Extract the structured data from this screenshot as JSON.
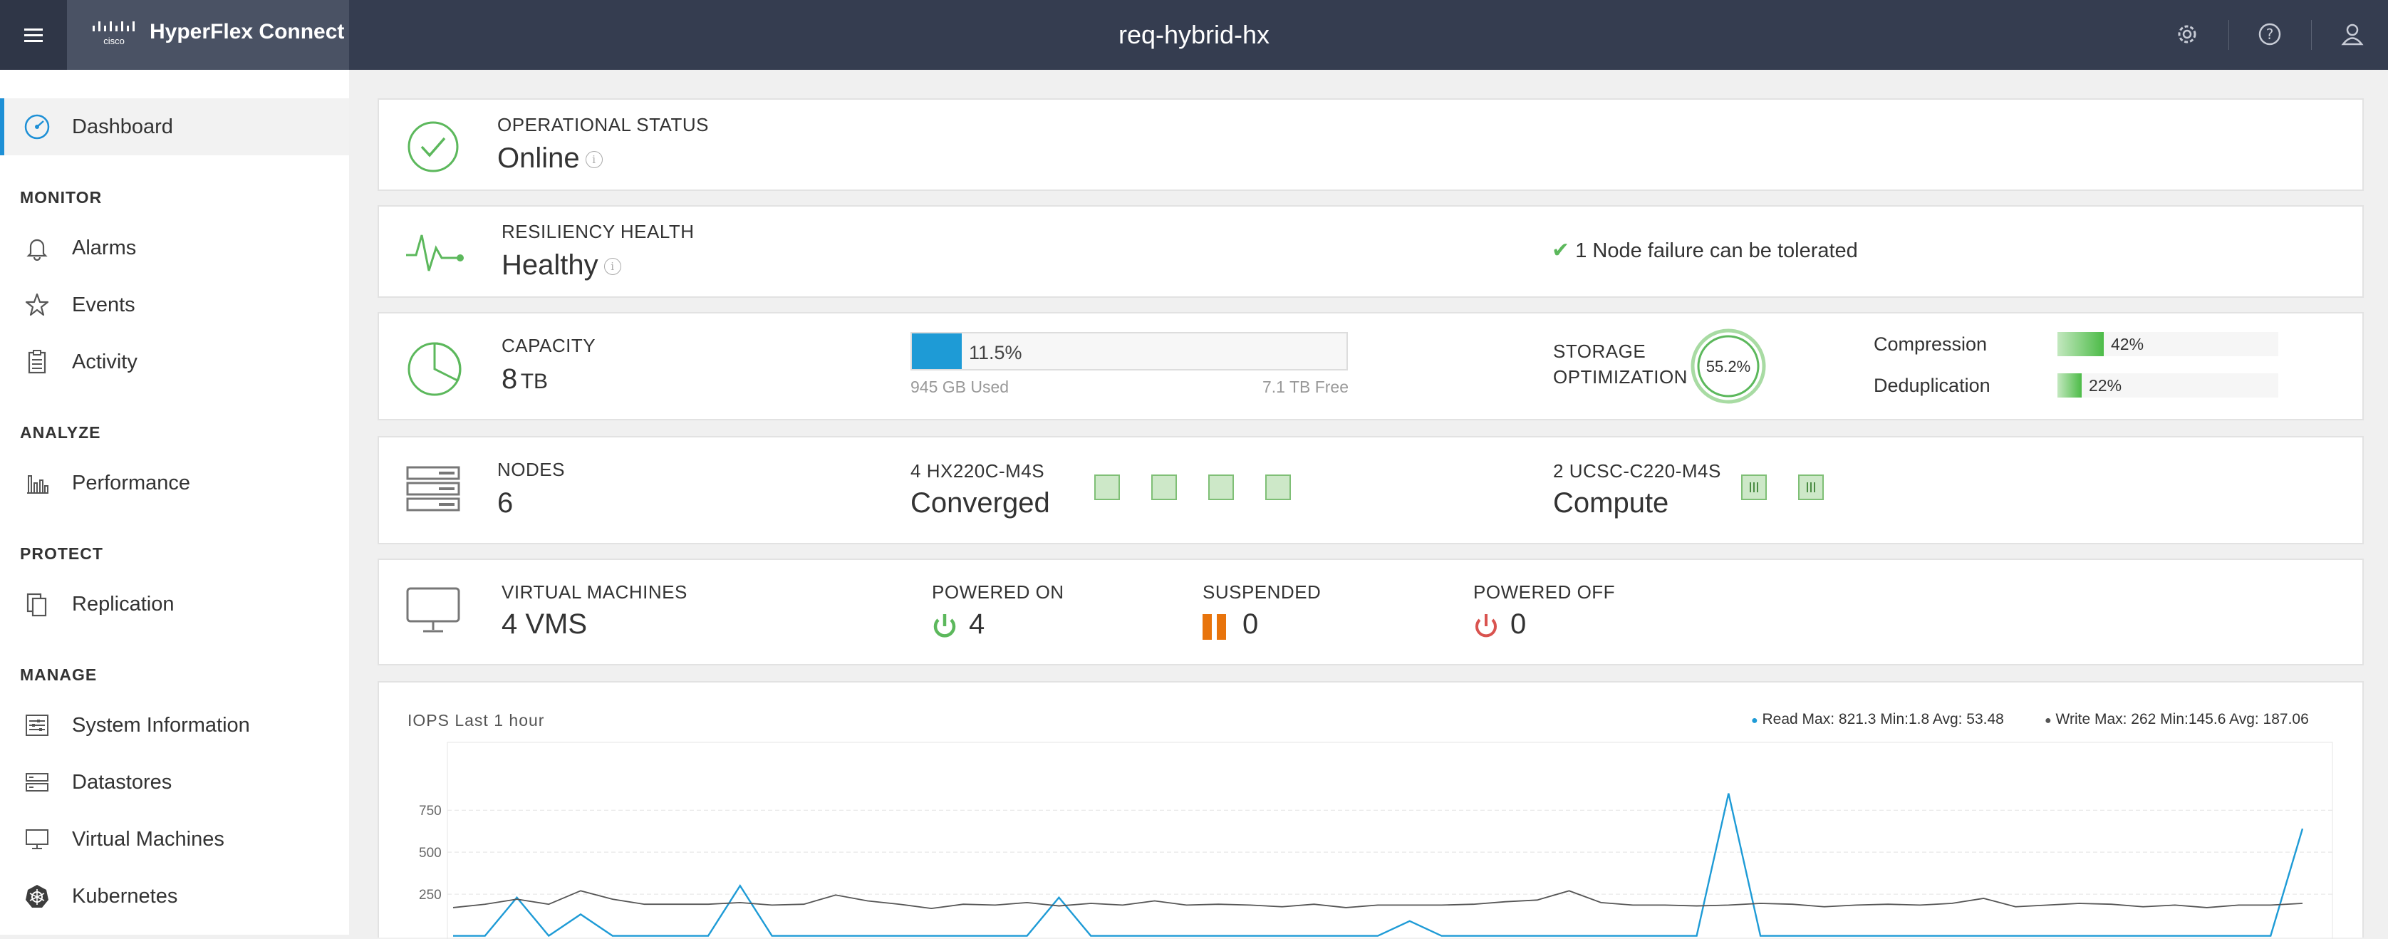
{
  "header": {
    "product": "HyperFlex Connect",
    "cluster_name": "req-hybrid-hx",
    "icons": [
      "menu-icon",
      "settings-icon",
      "help-icon",
      "user-icon"
    ]
  },
  "sidebar": {
    "dashboard": "Dashboard",
    "sections": {
      "monitor": "MONITOR",
      "analyze": "ANALYZE",
      "protect": "PROTECT",
      "manage": "MANAGE"
    },
    "items": {
      "alarms": "Alarms",
      "events": "Events",
      "activity": "Activity",
      "performance": "Performance",
      "replication": "Replication",
      "system_information": "System Information",
      "datastores": "Datastores",
      "virtual_machines": "Virtual Machines",
      "kubernetes": "Kubernetes"
    }
  },
  "operational": {
    "caption": "OPERATIONAL STATUS",
    "value": "Online"
  },
  "resiliency": {
    "caption": "RESILIENCY HEALTH",
    "value": "Healthy",
    "note": "1 Node failure can be tolerated"
  },
  "capacity": {
    "caption": "CAPACITY",
    "value": "8",
    "unit": "TB",
    "used_pct": 11.5,
    "used_pct_label": "11.5%",
    "used_label": "945 GB Used",
    "free_label": "7.1 TB Free",
    "optimization_caption_1": "STORAGE",
    "optimization_caption_2": "OPTIMIZATION",
    "optimization_value": "55.2%",
    "optimization_fraction": 0.552,
    "compression_label": "Compression",
    "compression_value": "42%",
    "compression_fraction": 0.42,
    "dedup_label": "Deduplication",
    "dedup_value": "22%",
    "dedup_fraction": 0.22
  },
  "nodes": {
    "caption": "NODES",
    "value": "6",
    "converged_count": "4",
    "converged_model": "HX220C-M4S",
    "converged_label": "Converged",
    "compute_count": "2",
    "compute_model": "UCSC-C220-M4S",
    "compute_label": "Compute"
  },
  "vms": {
    "caption": "VIRTUAL MACHINES",
    "value": "4 VMS",
    "powered_on_caption": "POWERED ON",
    "powered_on": "4",
    "suspended_caption": "SUSPENDED",
    "suspended": "0",
    "powered_off_caption": "POWERED OFF",
    "powered_off": "0"
  },
  "colors": {
    "accent_blue": "#1e9bd6",
    "green": "#5cb85c",
    "orange": "#e8740c",
    "red": "#d9534f",
    "write_line": "#555555"
  },
  "iops": {
    "title": "IOPS Last 1 hour",
    "read_legend": "Read Max: 821.3 Min:1.8 Avg: 53.48",
    "write_legend": "Write Max: 262 Min:145.6 Avg: 187.06"
  },
  "chart_data": {
    "type": "line",
    "title": "IOPS Last 1 hour",
    "xlabel": "",
    "ylabel": "",
    "yticks": [
      250,
      500,
      750
    ],
    "ylim": [
      0,
      900
    ],
    "x": [
      0,
      1,
      2,
      3,
      4,
      5,
      6,
      7,
      8,
      9,
      10,
      11,
      12,
      13,
      14,
      15,
      16,
      17,
      18,
      19,
      20,
      21,
      22,
      23,
      24,
      25,
      26,
      27,
      28,
      29,
      30,
      31,
      32,
      33,
      34,
      35,
      36,
      37,
      38,
      39,
      40,
      41,
      42,
      43,
      44,
      45,
      46,
      47,
      48,
      49,
      50,
      51,
      52,
      53,
      54,
      55,
      56,
      57,
      58
    ],
    "series": [
      {
        "name": "Read",
        "values": [
          2,
          2,
          230,
          2,
          130,
          2,
          2,
          2,
          2,
          300,
          2,
          2,
          2,
          2,
          2,
          2,
          2,
          2,
          2,
          230,
          2,
          2,
          2,
          2,
          2,
          2,
          2,
          2,
          2,
          2,
          90,
          2,
          2,
          2,
          2,
          2,
          2,
          2,
          2,
          2,
          850,
          2,
          2,
          2,
          2,
          2,
          2,
          2,
          2,
          2,
          2,
          2,
          2,
          2,
          2,
          2,
          2,
          2,
          640
        ]
      },
      {
        "name": "Write",
        "values": [
          170,
          190,
          220,
          190,
          270,
          220,
          190,
          190,
          190,
          200,
          185,
          190,
          245,
          210,
          190,
          165,
          190,
          185,
          200,
          180,
          195,
          185,
          210,
          185,
          190,
          185,
          175,
          190,
          170,
          185,
          185,
          185,
          190,
          205,
          215,
          270,
          200,
          185,
          185,
          180,
          185,
          195,
          190,
          175,
          185,
          190,
          185,
          195,
          225,
          175,
          185,
          195,
          190,
          175,
          185,
          170,
          185,
          185,
          195
        ]
      }
    ]
  }
}
